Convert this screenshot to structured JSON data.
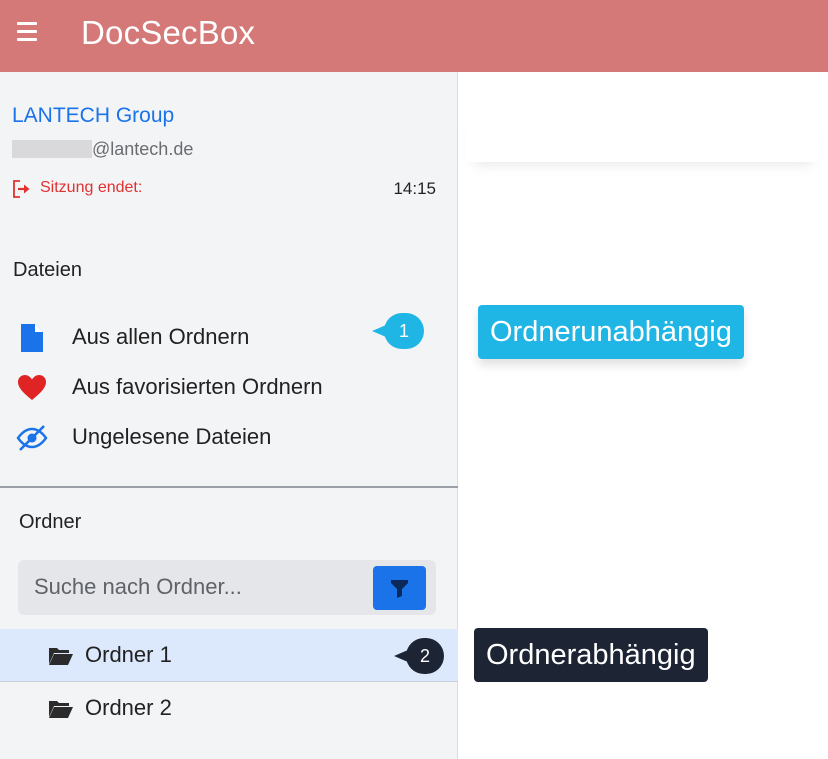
{
  "header": {
    "title": "DocSecBox",
    "menu_icon": "hamburger-menu-icon",
    "background_color": "#d47878"
  },
  "account": {
    "org_name": "LANTECH Group",
    "email_domain": "@lantech.de",
    "session_label": "Sitzung endet:",
    "session_time": "14:15",
    "session_icon": "logout-icon"
  },
  "files": {
    "title": "Dateien",
    "items": [
      {
        "label": "Aus allen Ordnern",
        "icon": "document-icon"
      },
      {
        "label": "Aus favorisierten Ordnern",
        "icon": "heart-icon"
      },
      {
        "label": "Ungelesene Dateien",
        "icon": "eye-slash-icon"
      }
    ],
    "badge": "1"
  },
  "folders": {
    "title": "Ordner",
    "search_placeholder": "Suche nach Ordner...",
    "filter_icon": "filter-icon",
    "items": [
      {
        "label": "Ordner 1",
        "icon": "folder-open-icon",
        "selected": true
      },
      {
        "label": "Ordner 2",
        "icon": "folder-open-icon",
        "selected": false
      }
    ],
    "badge": "2"
  },
  "annotations": {
    "independent": "Ordnerunabhängig",
    "dependent": "Ordnerabhängig"
  },
  "colors": {
    "accent_blue": "#1a73e8",
    "callout_cyan": "#1fb6e6",
    "callout_dark": "#1d2535",
    "danger_red": "#e03131"
  }
}
